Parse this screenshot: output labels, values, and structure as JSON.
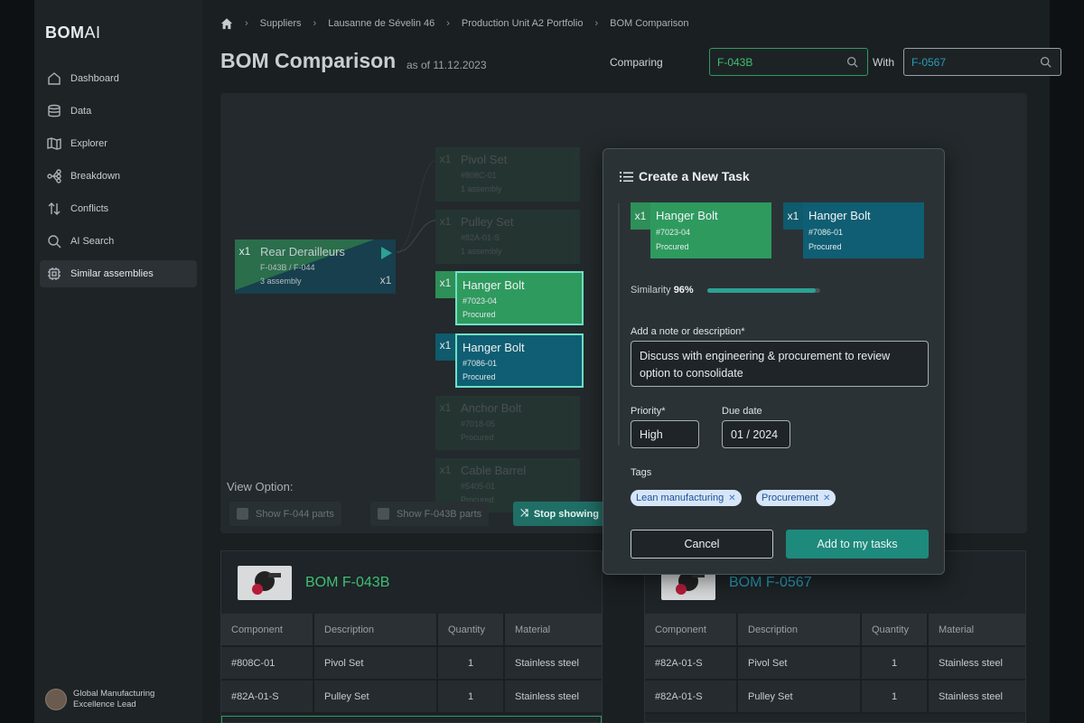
{
  "app": {
    "logo_bold": "BOM",
    "logo_light": "AI"
  },
  "sidebar": {
    "items": [
      {
        "label": "Dashboard",
        "icon": "home-icon"
      },
      {
        "label": "Data",
        "icon": "database-icon"
      },
      {
        "label": "Explorer",
        "icon": "map-icon"
      },
      {
        "label": "Breakdown",
        "icon": "tree-icon"
      },
      {
        "label": "Conflicts",
        "icon": "sort-arrows-icon"
      },
      {
        "label": "AI Search",
        "icon": "search-icon"
      },
      {
        "label": "Similar assemblies",
        "icon": "chip-icon",
        "active": true
      }
    ],
    "user": {
      "name": "Global Manufacturing Excellence Lead"
    }
  },
  "breadcrumb": [
    "Suppliers",
    "Lausanne de Sévelin 46",
    "Production Unit A2 Portfolio",
    "BOM Comparison"
  ],
  "header": {
    "title": "BOM Comparison",
    "as_of": "as of 11.12.2023",
    "comparing_label": "Comparing",
    "comparing_value": "F-043B",
    "with_label": "With",
    "with_value": "F-0567"
  },
  "colors": {
    "green": "#2e9a5e",
    "teal": "#0f5e73",
    "accent": "#1e8a7c"
  },
  "canvas": {
    "root": {
      "qty": "x1",
      "name": "Rear Derailleurs",
      "code": "F-043B / F-044",
      "sub": "3 assembly",
      "qty_right": "x1"
    },
    "nodes": [
      {
        "qty": "x1",
        "name": "Pivol Set",
        "code": "#808C-01",
        "sub": "1 assembly",
        "faded": true
      },
      {
        "qty": "x1",
        "name": "Pulley Set",
        "code": "#82A-01-S",
        "sub": "1 assembly",
        "faded": true
      },
      {
        "qty": "x1",
        "name": "Hanger Bolt",
        "code": "#7023-04",
        "sub": "Procured"
      },
      {
        "qty": "x1",
        "name": "Hanger Bolt",
        "code": "#7086-01",
        "sub": "Procured"
      },
      {
        "qty": "x1",
        "name": "Anchor Bolt",
        "code": "#7018-05",
        "sub": "Procured",
        "faded": true
      },
      {
        "qty": "x1",
        "name": "Cable Barrel",
        "code": "#5405-01",
        "sub": "Procured",
        "faded": true
      }
    ],
    "view_option_label": "View Option:",
    "show_a": "Show F-044 parts",
    "show_b": "Show F-043B parts",
    "stop_label": "Stop showing"
  },
  "bom_left": {
    "title": "BOM F-043B",
    "columns": [
      "Component",
      "Description",
      "Quantity",
      "Material"
    ],
    "rows": [
      [
        "#808C-01",
        "Pivol Set",
        "1",
        "Stainless steel"
      ],
      [
        "#82A-01-S",
        "Pulley Set",
        "1",
        "Stainless steel"
      ]
    ]
  },
  "bom_right": {
    "title": "BOM F-0567",
    "columns": [
      "Component",
      "Description",
      "Quantity",
      "Material"
    ],
    "rows": [
      [
        "#82A-01-S",
        "Pivol Set",
        "1",
        "Stainless steel"
      ],
      [
        "#82A-01-S",
        "Pulley Set",
        "1",
        "Stainless steel"
      ]
    ]
  },
  "modal": {
    "title": "Create a New Task",
    "card_a": {
      "qty": "x1",
      "name": "Hanger Bolt",
      "code": "#7023-04",
      "status": "Procured"
    },
    "card_b": {
      "qty": "x1",
      "name": "Hanger Bolt",
      "code": "#7086-01",
      "status": "Procured"
    },
    "similarity_label": "Similarity",
    "similarity_value": "96%",
    "similarity_fraction": 0.96,
    "note_label": "Add a note or description*",
    "note_value": "Discuss with engineering & procurement to review option to consolidate",
    "priority_label": "Priority*",
    "priority_value": "High",
    "due_label": "Due date",
    "due_value": "01 / 2024",
    "tags_label": "Tags",
    "tags": [
      "Lean manufacturing",
      "Procurement"
    ],
    "cancel_label": "Cancel",
    "add_label": "Add to my tasks"
  }
}
